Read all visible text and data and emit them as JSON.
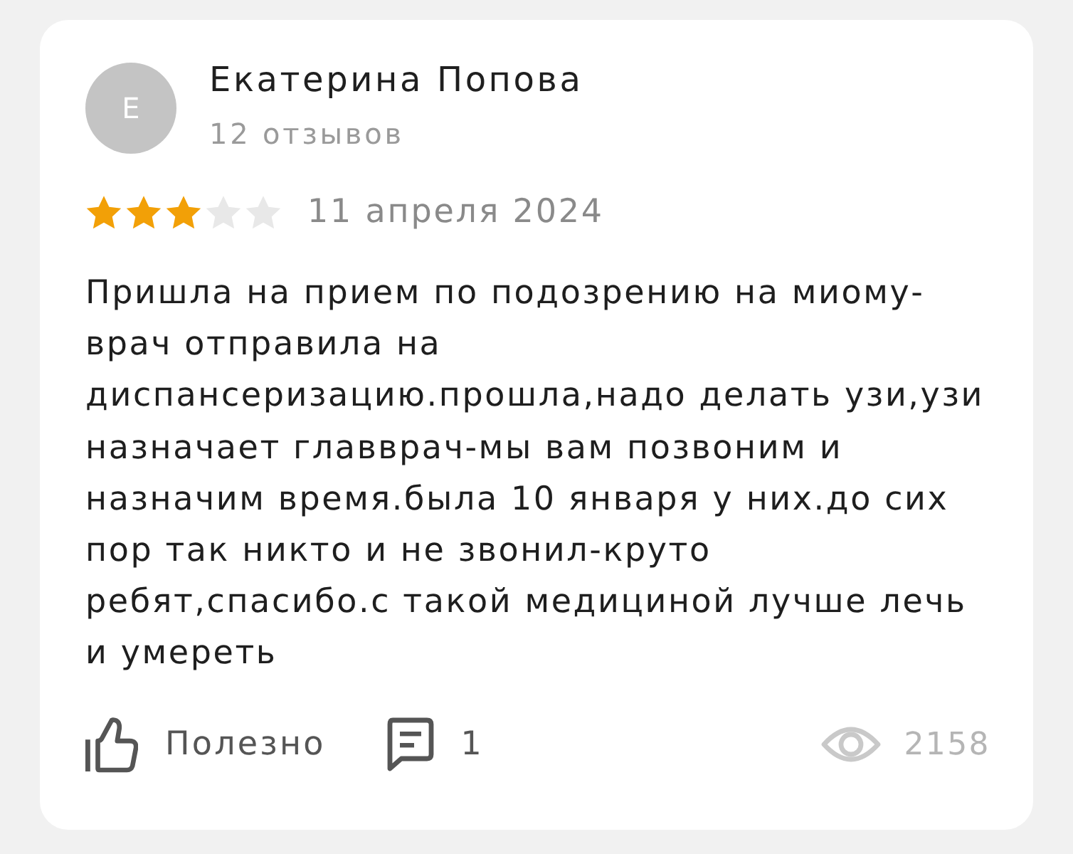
{
  "author": {
    "avatar_letter": "Е",
    "name": "Екатерина Попова",
    "reviews_count": "12 отзывов"
  },
  "rating": {
    "stars": 3,
    "date": "11 апреля 2024"
  },
  "text": "Пришла на прием по подозрению на миому-врач отправила на диспансеризацию.прошла,надо делать узи,узи назначает главврач-мы вам позвоним и назначим время.была 10 января у них.до сих пор так никто и не звонил-круто ребят,спасибо.с такой медициной лучше лечь и умереть",
  "footer": {
    "helpful_label": "Полезно",
    "comments_count": "1",
    "views_count": "2158"
  }
}
